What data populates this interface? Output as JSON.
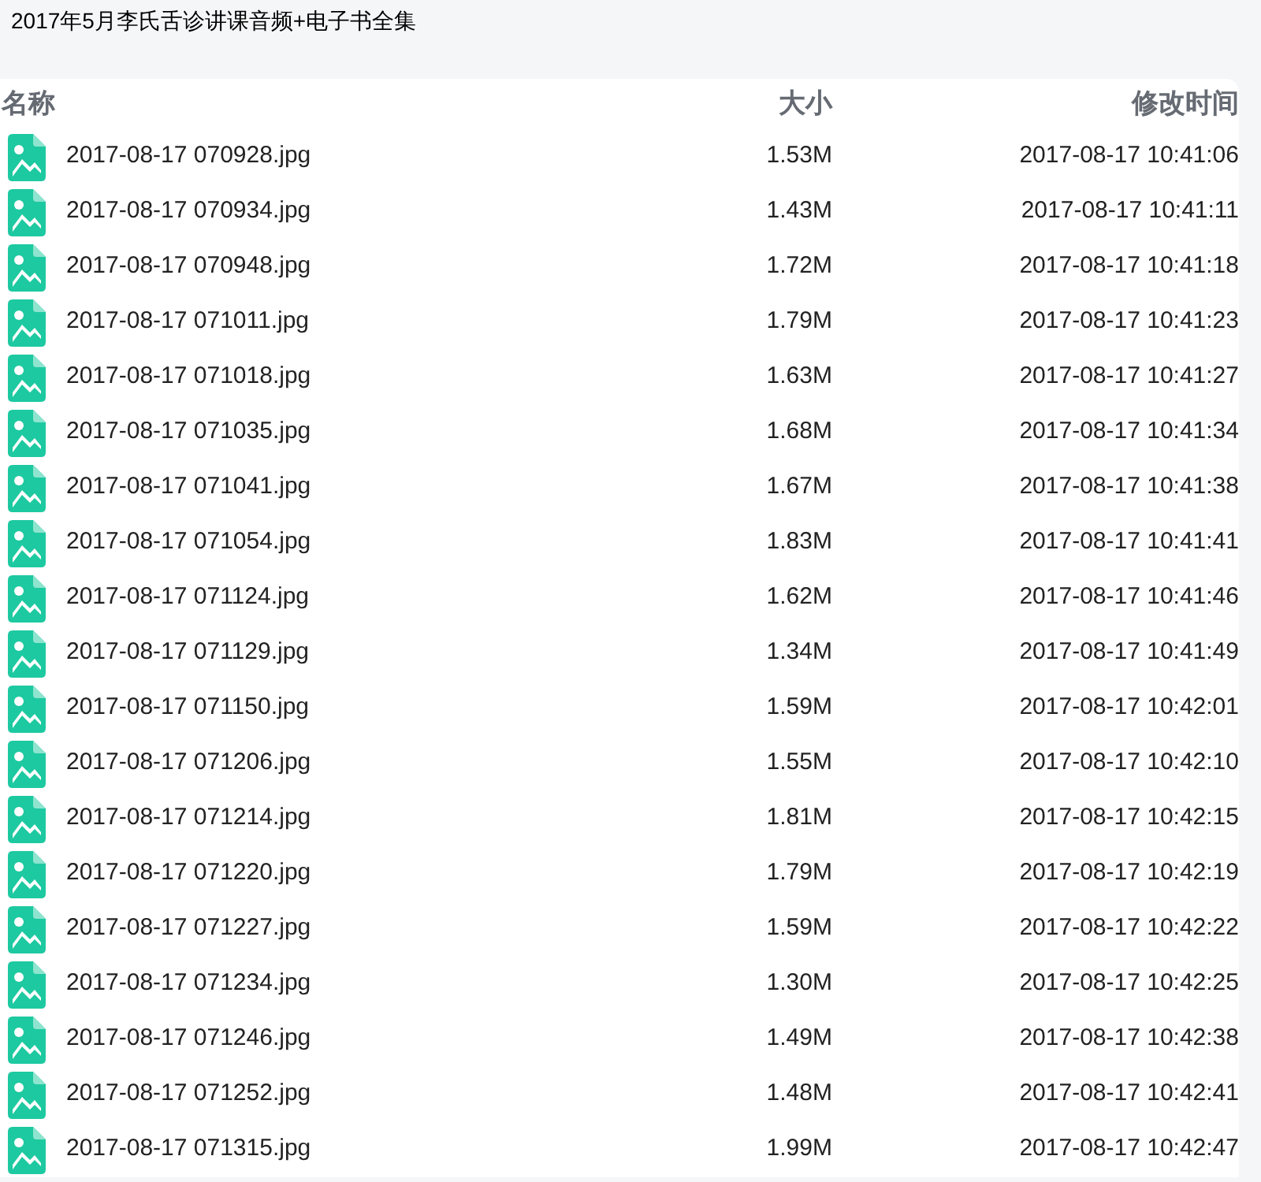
{
  "title": "2017年5月李氏舌诊讲课音频+电子书全集",
  "table": {
    "columns": [
      "名称",
      "大小",
      "修改时间"
    ],
    "rows": [
      {
        "name": "2017-08-17 070928.jpg",
        "size": "1.53M",
        "modified": "2017-08-17 10:41:06"
      },
      {
        "name": "2017-08-17 070934.jpg",
        "size": "1.43M",
        "modified": "2017-08-17 10:41:11"
      },
      {
        "name": "2017-08-17 070948.jpg",
        "size": "1.72M",
        "modified": "2017-08-17 10:41:18"
      },
      {
        "name": "2017-08-17 071011.jpg",
        "size": "1.79M",
        "modified": "2017-08-17 10:41:23"
      },
      {
        "name": "2017-08-17 071018.jpg",
        "size": "1.63M",
        "modified": "2017-08-17 10:41:27"
      },
      {
        "name": "2017-08-17 071035.jpg",
        "size": "1.68M",
        "modified": "2017-08-17 10:41:34"
      },
      {
        "name": "2017-08-17 071041.jpg",
        "size": "1.67M",
        "modified": "2017-08-17 10:41:38"
      },
      {
        "name": "2017-08-17 071054.jpg",
        "size": "1.83M",
        "modified": "2017-08-17 10:41:41"
      },
      {
        "name": "2017-08-17 071124.jpg",
        "size": "1.62M",
        "modified": "2017-08-17 10:41:46"
      },
      {
        "name": "2017-08-17 071129.jpg",
        "size": "1.34M",
        "modified": "2017-08-17 10:41:49"
      },
      {
        "name": "2017-08-17 071150.jpg",
        "size": "1.59M",
        "modified": "2017-08-17 10:42:01"
      },
      {
        "name": "2017-08-17 071206.jpg",
        "size": "1.55M",
        "modified": "2017-08-17 10:42:10"
      },
      {
        "name": "2017-08-17 071214.jpg",
        "size": "1.81M",
        "modified": "2017-08-17 10:42:15"
      },
      {
        "name": "2017-08-17 071220.jpg",
        "size": "1.79M",
        "modified": "2017-08-17 10:42:19"
      },
      {
        "name": "2017-08-17 071227.jpg",
        "size": "1.59M",
        "modified": "2017-08-17 10:42:22"
      },
      {
        "name": "2017-08-17 071234.jpg",
        "size": "1.30M",
        "modified": "2017-08-17 10:42:25"
      },
      {
        "name": "2017-08-17 071246.jpg",
        "size": "1.49M",
        "modified": "2017-08-17 10:42:38"
      },
      {
        "name": "2017-08-17 071252.jpg",
        "size": "1.48M",
        "modified": "2017-08-17 10:42:41"
      },
      {
        "name": "2017-08-17 071315.jpg",
        "size": "1.99M",
        "modified": "2017-08-17 10:42:47"
      }
    ]
  }
}
